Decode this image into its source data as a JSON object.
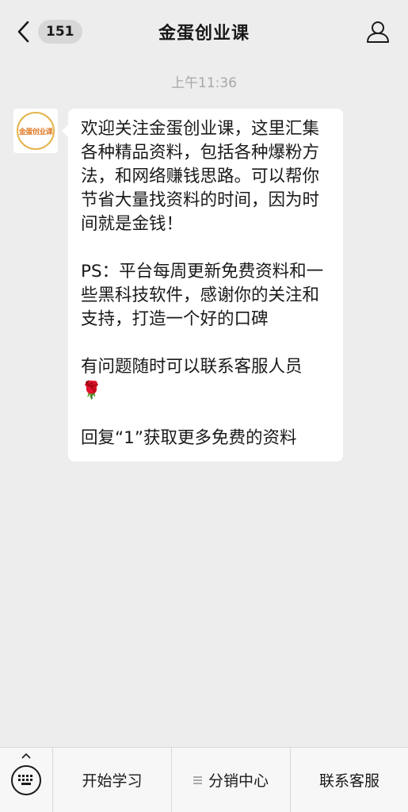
{
  "header": {
    "unread_count": "151",
    "title": "金蛋创业课"
  },
  "timestamp": "上午11:36",
  "message": {
    "avatar_text": "金蛋创业课",
    "paragraphs": [
      "欢迎关注金蛋创业课，这里汇集各种精品资料，包括各种爆粉方法，和网络赚钱思路。可以帮你节省大量找资料的时间，因为时间就是金钱！",
      "PS：平台每周更新免费资料和一些黑科技软件，感谢你的关注和支持，打造一个好的口碑",
      "有问题随时可以联系客服人员",
      "回复“1”获取更多免费的资料"
    ],
    "emoji": "🌹"
  },
  "bottom_menu": {
    "item1": "开始学习",
    "item2": "分销中心",
    "item3": "联系客服"
  },
  "colors": {
    "background": "#ededed",
    "bubble": "#ffffff",
    "badge": "#d7d7d7",
    "emoji_red": "#d2232a"
  }
}
